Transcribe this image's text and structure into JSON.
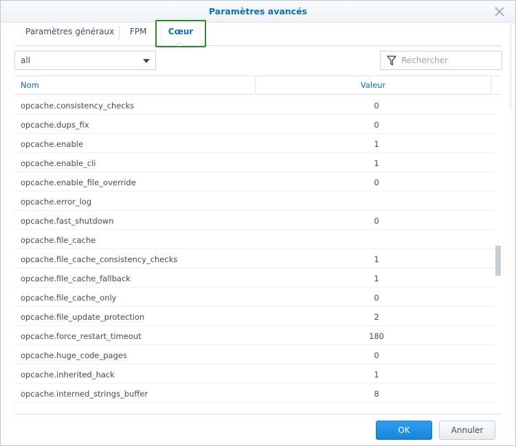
{
  "dialog": {
    "title": "Paramètres avancés"
  },
  "tabs": [
    {
      "label": "Paramètres généraux",
      "active": false
    },
    {
      "label": "FPM",
      "active": false
    },
    {
      "label": "Cœur",
      "active": true
    }
  ],
  "filter": {
    "value": "all"
  },
  "search": {
    "placeholder": "Rechercher"
  },
  "grid": {
    "columns": [
      "Nom",
      "Valeur"
    ],
    "rows": [
      {
        "name": "opcache.consistency_checks",
        "value": "0"
      },
      {
        "name": "opcache.dups_fix",
        "value": "0"
      },
      {
        "name": "opcache.enable",
        "value": "1"
      },
      {
        "name": "opcache.enable_cli",
        "value": "1"
      },
      {
        "name": "opcache.enable_file_override",
        "value": "0"
      },
      {
        "name": "opcache.error_log",
        "value": ""
      },
      {
        "name": "opcache.fast_shutdown",
        "value": "0"
      },
      {
        "name": "opcache.file_cache",
        "value": ""
      },
      {
        "name": "opcache.file_cache_consistency_checks",
        "value": "1"
      },
      {
        "name": "opcache.file_cache_fallback",
        "value": "1"
      },
      {
        "name": "opcache.file_cache_only",
        "value": "0"
      },
      {
        "name": "opcache.file_update_protection",
        "value": "2"
      },
      {
        "name": "opcache.force_restart_timeout",
        "value": "180"
      },
      {
        "name": "opcache.huge_code_pages",
        "value": "0"
      },
      {
        "name": "opcache.inherited_hack",
        "value": "1"
      },
      {
        "name": "opcache.interned_strings_buffer",
        "value": "8"
      }
    ]
  },
  "buttons": {
    "ok": "OK",
    "cancel": "Annuler"
  },
  "icons": {
    "close": "close-icon",
    "filter": "filter-icon",
    "dropdown": "chevron-down-icon"
  },
  "colors": {
    "accent": "#0f6fa8",
    "primary_button": "#1a8ae0",
    "tab_highlight": "#2e8b1e"
  }
}
